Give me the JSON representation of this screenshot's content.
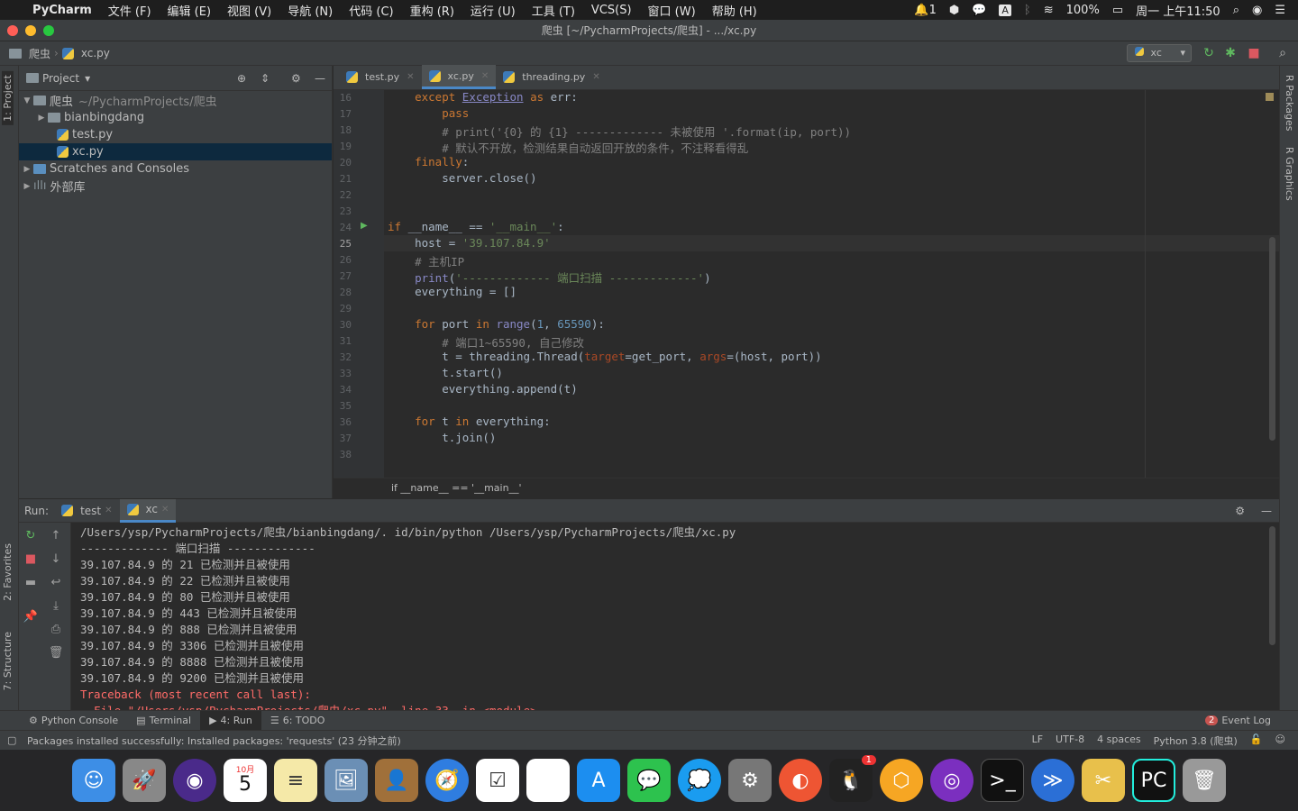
{
  "menubar": {
    "app": "PyCharm",
    "items": [
      "文件 (F)",
      "编辑 (E)",
      "视图 (V)",
      "导航 (N)",
      "代码 (C)",
      "重构 (R)",
      "运行 (U)",
      "工具 (T)",
      "VCS(S)",
      "窗口 (W)",
      "帮助 (H)"
    ],
    "notif_count": "1",
    "battery": "100%",
    "clock": "周一 上午11:50"
  },
  "window": {
    "title": "爬虫 [~/PycharmProjects/爬虫] - .../xc.py"
  },
  "navbar": {
    "crumbs": [
      "爬虫",
      "xc.py"
    ],
    "run_config": "xc"
  },
  "left_strip": {
    "project": "1: Project",
    "favorites": "2: Favorites",
    "structure": "7: Structure"
  },
  "right_strip": {
    "packages": "R Packages",
    "graphics": "R Graphics"
  },
  "project": {
    "header": "Project",
    "tree": [
      {
        "label": "爬虫",
        "extra": "~/PycharmProjects/爬虫"
      },
      {
        "label": "bianbingdang"
      },
      {
        "label": "test.py"
      },
      {
        "label": "xc.py"
      },
      {
        "label": "Scratches and Consoles"
      },
      {
        "label": "外部库"
      }
    ]
  },
  "editor": {
    "tabs": [
      "test.py",
      "xc.py",
      "threading.py"
    ],
    "line_numbers": [
      "16",
      "17",
      "18",
      "19",
      "20",
      "21",
      "22",
      "23",
      "24",
      "25",
      "26",
      "27",
      "28",
      "29",
      "30",
      "31",
      "32",
      "33",
      "34",
      "35",
      "36",
      "37",
      "38"
    ],
    "breadcrumb": "if __name__ == '__main__'"
  },
  "run": {
    "label": "Run:",
    "tabs": [
      "test",
      "xc"
    ],
    "console": [
      "/Users/ysp/PycharmProjects/爬虫/bianbingdang/. id/bin/python /Users/ysp/PycharmProjects/爬虫/xc.py",
      "------------- 端口扫描 -------------",
      "39.107.84.9 的 21 已检测并且被使用",
      "39.107.84.9 的 22 已检测并且被使用",
      "39.107.84.9 的 80 已检测并且被使用",
      "39.107.84.9 的 443 已检测并且被使用",
      "39.107.84.9 的 888 已检测并且被使用",
      "39.107.84.9 的 3306 已检测并且被使用",
      "39.107.84.9 的 8888 已检测并且被使用",
      "39.107.84.9 的 9200 已检测并且被使用"
    ],
    "traceback": "Traceback (most recent call last):",
    "traceback_cut": "  File \"/Users/ysp/PycharmProjects/爬虫/xc.py\", line 33, in <module>"
  },
  "bottom_tools": [
    "Python Console",
    "Terminal",
    "4: Run",
    "6: TODO"
  ],
  "event_log": {
    "count": "2",
    "label": "Event Log"
  },
  "status": {
    "message": "Packages installed successfully: Installed packages: 'requests' (23 分钟之前)",
    "line_sep": "LF",
    "encoding": "UTF-8",
    "indent": "4 spaces",
    "interpreter": "Python 3.8 (爬虫)"
  },
  "dock": {
    "calendar_month": "10月",
    "calendar_day": "5",
    "qq_badge": "1"
  }
}
